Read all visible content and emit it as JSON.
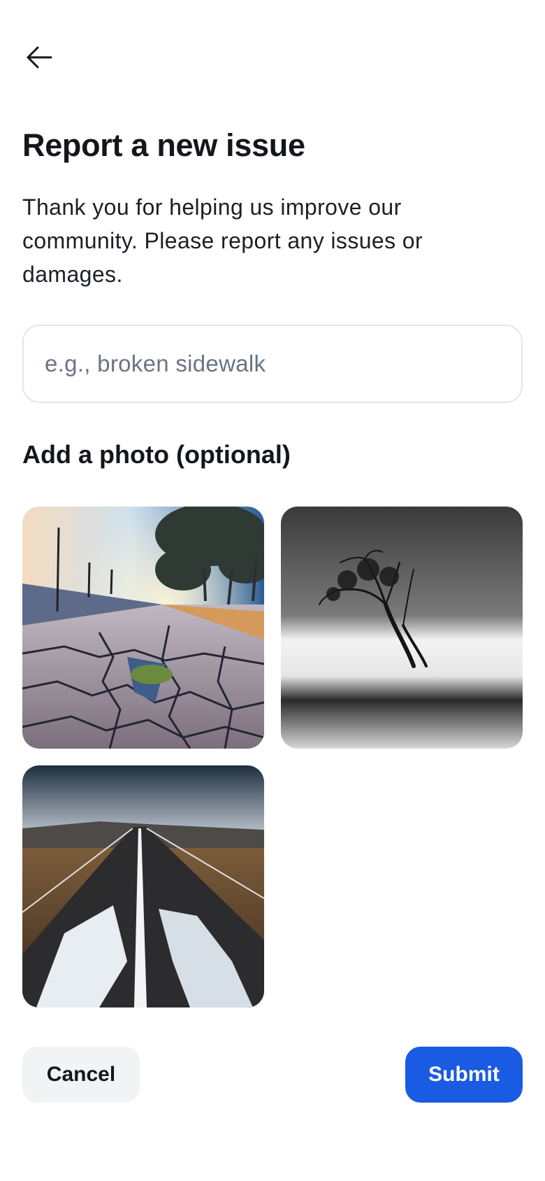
{
  "header": {
    "back_icon": "arrow-left-icon",
    "title": "Report a new issue",
    "subtitle": "Thank you for helping us improve our community. Please report any issues or damages."
  },
  "issue_input": {
    "value": "",
    "placeholder": "e.g., broken sidewalk"
  },
  "photos": {
    "section_title": "Add a photo (optional)",
    "items": [
      {
        "subject": "cracked sidewalk at sunset"
      },
      {
        "subject": "lone tree in misty water, black and white"
      },
      {
        "subject": "damaged road with water-filled potholes"
      }
    ]
  },
  "actions": {
    "cancel_label": "Cancel",
    "submit_label": "Submit"
  },
  "colors": {
    "accent": "#1a5be3",
    "cancel_bg": "#f2f3f5",
    "text_primary": "#14161c",
    "placeholder": "#6b7385",
    "input_border": "#e3e6ec"
  }
}
